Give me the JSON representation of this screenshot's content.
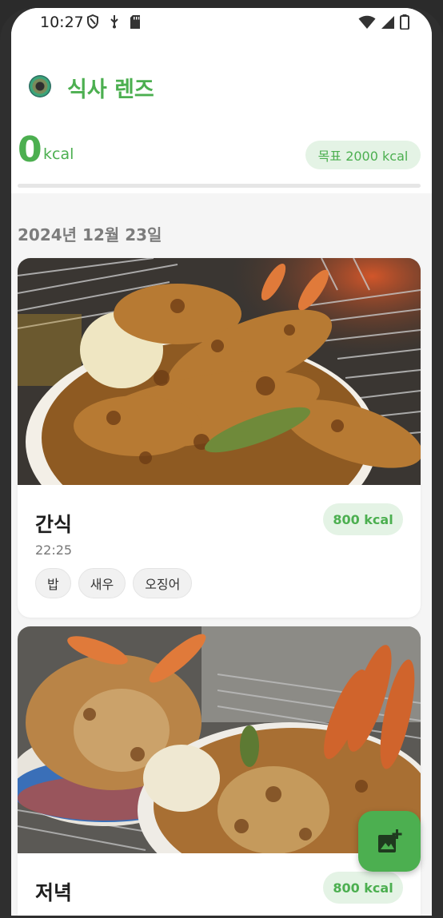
{
  "status_bar": {
    "time": "10:27",
    "icons_left": [
      "shield-icon",
      "usb-debug-icon",
      "sd-card-icon"
    ],
    "icons_right": [
      "wifi-icon",
      "signal-icon",
      "battery-icon"
    ]
  },
  "app": {
    "title": "식사 렌즈",
    "logo_icon": "camera-lens-logo"
  },
  "summary": {
    "kcal_value": "0",
    "kcal_unit": "kcal",
    "goal_label": "목표 2000 kcal",
    "progress": 0
  },
  "date_label": "2024년 12월 23일",
  "meals": [
    {
      "title": "간식",
      "kcal": "800 kcal",
      "time": "22:25",
      "tags": [
        "밥",
        "새우",
        "오징어"
      ],
      "photo": "tempura-bowl-photo"
    },
    {
      "title": "저녁",
      "kcal": "800 kcal",
      "photo": "tempura-bowls-photo"
    }
  ],
  "fab": {
    "icon": "add-photo-icon"
  },
  "colors": {
    "accent": "#4caf50",
    "accent_light": "#e4f3e5",
    "background": "#f5f5f5"
  }
}
